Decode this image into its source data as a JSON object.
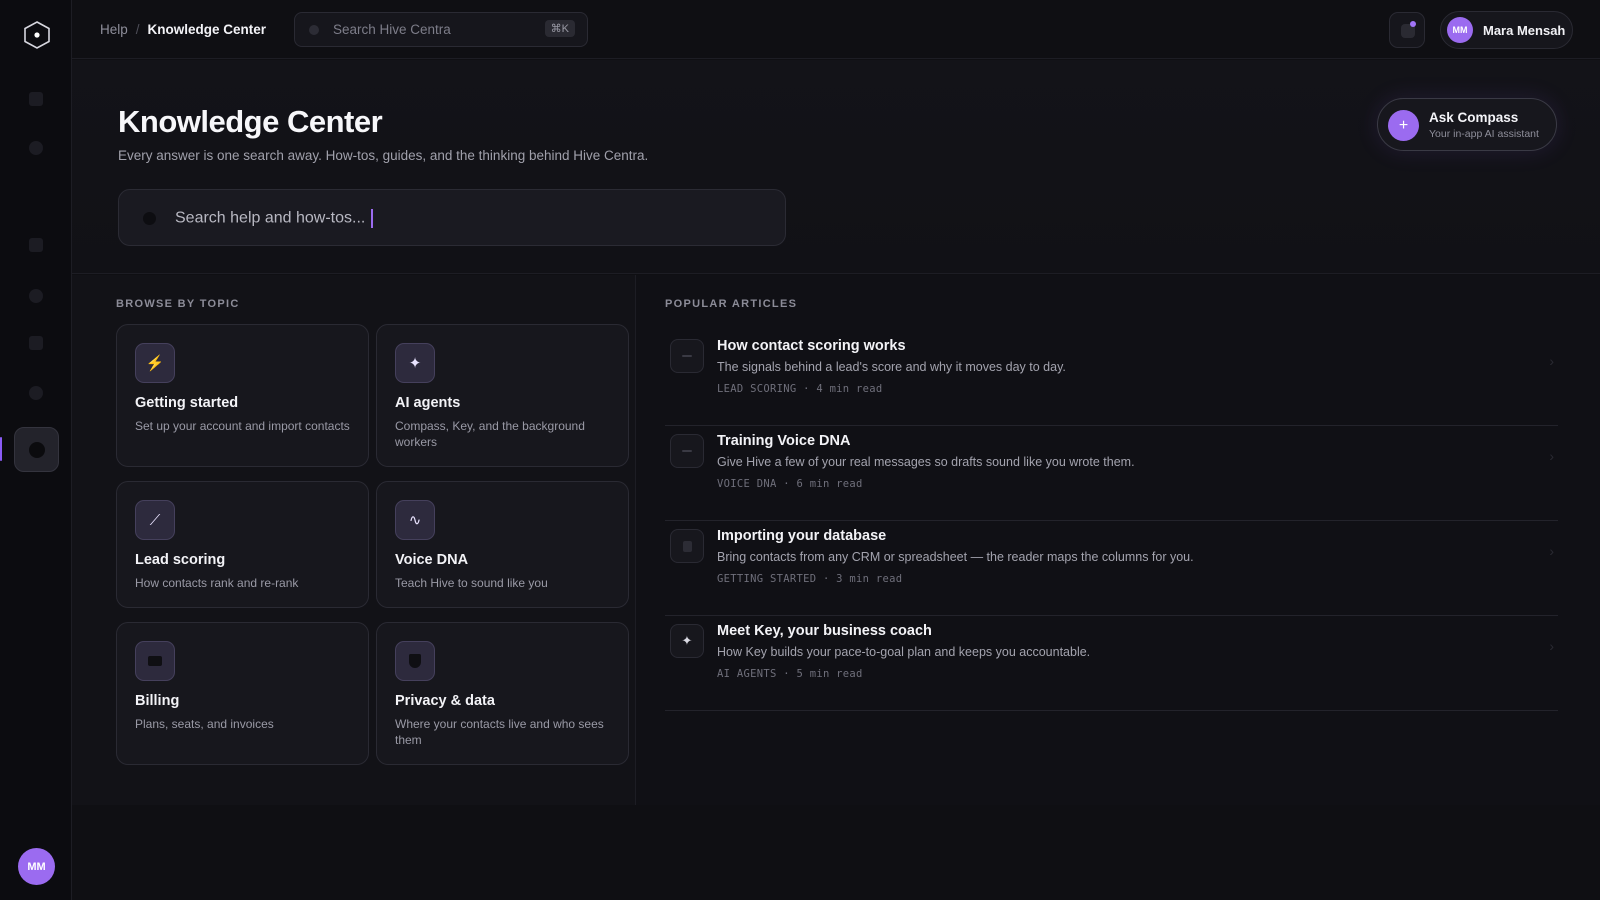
{
  "app": {
    "accent_color": "#9b6bf0"
  },
  "sidebar": {
    "avatar_initials": "MM",
    "items": [
      {
        "icon": "grid-icon"
      },
      {
        "icon": "person-icon"
      },
      {
        "icon": "inbox-icon"
      },
      {
        "icon": "target-icon"
      },
      {
        "icon": "chat-icon"
      },
      {
        "icon": "gear-icon"
      },
      {
        "icon": "help-icon",
        "active": true
      }
    ]
  },
  "header": {
    "breadcrumb": {
      "parent": "Help",
      "separator": "/",
      "current": "Knowledge Center"
    },
    "search": {
      "placeholder": "Search Hive Centra",
      "shortcut": "⌘K"
    },
    "user": {
      "initials": "MM",
      "name": "Mara Mensah"
    }
  },
  "hero": {
    "title": "Knowledge Center",
    "subtitle": "Every answer is one search away. How-tos, guides, and the thinking behind Hive Centra.",
    "search_placeholder": "Search help and how-tos...",
    "ask": {
      "label": "Ask Compass",
      "sublabel": "Your in-app AI assistant",
      "icon": "plus-icon"
    }
  },
  "topics": {
    "heading": "BROWSE BY TOPIC",
    "items": [
      {
        "title": "Getting started",
        "description": "Set up your account and import contacts",
        "icon": "bolt-icon",
        "glyph": "⚡"
      },
      {
        "title": "AI agents",
        "description": "Compass, Key, and the background workers",
        "icon": "sparkle-icon",
        "glyph": "✦"
      },
      {
        "title": "Lead scoring",
        "description": "How contacts rank and re-rank",
        "icon": "trend-icon",
        "glyph": "⟋"
      },
      {
        "title": "Voice DNA",
        "description": "Teach Hive to sound like you",
        "icon": "waveform-icon",
        "glyph": "∿"
      },
      {
        "title": "Billing",
        "description": "Plans, seats, and invoices",
        "icon": "card-icon",
        "glyph": ""
      },
      {
        "title": "Privacy & data",
        "description": "Where your contacts live and who sees them",
        "icon": "shield-icon",
        "glyph": ""
      }
    ]
  },
  "articles": {
    "heading": "POPULAR ARTICLES",
    "items": [
      {
        "title": "How contact scoring works",
        "description": "The signals behind a lead's score and why it moves day to day.",
        "meta": "LEAD SCORING · 4 min read",
        "icon": "trend-icon"
      },
      {
        "title": "Training Voice DNA",
        "description": "Give Hive a few of your real messages so drafts sound like you wrote them.",
        "meta": "VOICE DNA · 6 min read",
        "icon": "waveform-icon"
      },
      {
        "title": "Importing your database",
        "description": "Bring contacts from any CRM or spreadsheet — the reader maps the columns for you.",
        "meta": "GETTING STARTED · 3 min read",
        "icon": "file-icon"
      },
      {
        "title": "Meet Key, your business coach",
        "description": "How Key builds your pace-to-goal plan and keeps you accountable.",
        "meta": "AI AGENTS · 5 min read",
        "icon": "sparkle-icon"
      }
    ]
  }
}
